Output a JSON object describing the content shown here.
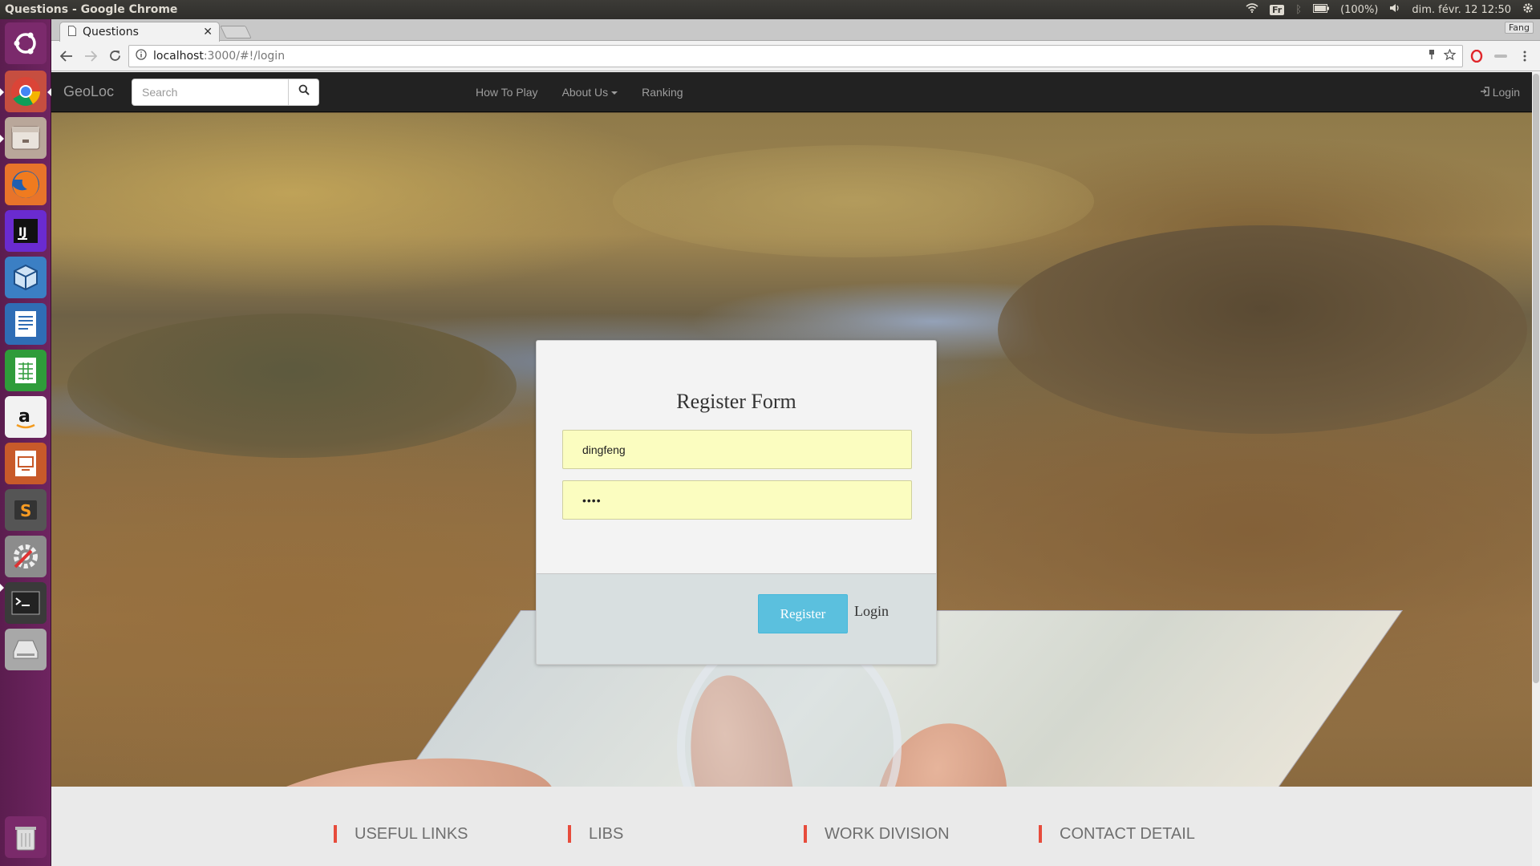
{
  "os": {
    "window_title": "Questions - Google Chrome",
    "keyboard_layout": "Fr",
    "battery": "(100%)",
    "datetime": "dim. févr. 12 12:50"
  },
  "browser": {
    "tab_title": "Questions",
    "profile_name": "Fang",
    "url_host": "localhost",
    "url_path": ":3000/#!/login"
  },
  "navbar": {
    "brand": "GeoLoc",
    "search_placeholder": "Search",
    "links": [
      "How To Play",
      "About Us",
      "Ranking"
    ],
    "login_label": "Login"
  },
  "register_form": {
    "title": "Register Form",
    "username_value": "dingfeng",
    "password_mask": "••••",
    "register_label": "Register",
    "login_label": "Login"
  },
  "footer": {
    "columns": [
      "USEFUL LINKS",
      "LIBS",
      "WORK DIVISION",
      "CONTACT DETAIL"
    ]
  },
  "colors": {
    "launcher": "#6e2460",
    "navbar": "#222222",
    "register_button": "#5bc0de",
    "field_fill": "#fbfdc0",
    "footer_accent": "#e74c3c"
  }
}
